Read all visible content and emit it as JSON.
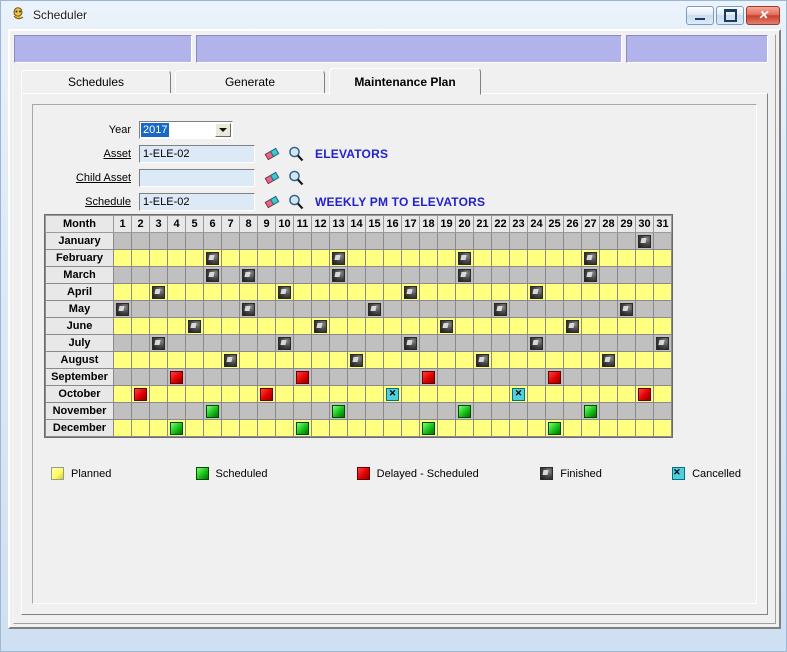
{
  "window": {
    "title": "Scheduler",
    "icon": "scheduler-app-icon",
    "buttons": {
      "minimize": "minimize-icon",
      "maximize": "maximize-icon",
      "close": "close-icon"
    }
  },
  "header_panels": [
    "",
    "",
    ""
  ],
  "tabs": [
    {
      "label": "Schedules",
      "active": false
    },
    {
      "label": "Generate",
      "active": false
    },
    {
      "label": "Maintenance Plan",
      "active": true
    }
  ],
  "form": {
    "year": {
      "label": "Year",
      "value": "2017",
      "selected": true
    },
    "asset": {
      "label": "Asset",
      "value": "1-ELE-02",
      "description": "ELEVATORS"
    },
    "child_asset": {
      "label": "Child Asset",
      "value": "",
      "description": ""
    },
    "schedule": {
      "label": "Schedule",
      "value": "1-ELE-02",
      "description": "WEEKLY PM TO ELEVATORS"
    },
    "icons": {
      "erase": "eraser-icon",
      "find": "magnifier-icon"
    }
  },
  "calendar": {
    "month_header": "Month",
    "days": [
      1,
      2,
      3,
      4,
      5,
      6,
      7,
      8,
      9,
      10,
      11,
      12,
      13,
      14,
      15,
      16,
      17,
      18,
      19,
      20,
      21,
      22,
      23,
      24,
      25,
      26,
      27,
      28,
      29,
      30,
      31
    ],
    "rows": [
      {
        "month": "January",
        "band": "gray",
        "marks": {
          "30": "finished"
        }
      },
      {
        "month": "February",
        "band": "yellow",
        "marks": {
          "6": "finished",
          "13": "finished",
          "20": "finished",
          "27": "finished"
        }
      },
      {
        "month": "March",
        "band": "gray",
        "marks": {
          "6": "finished",
          "8": "finished",
          "13": "finished",
          "20": "finished",
          "27": "finished"
        }
      },
      {
        "month": "April",
        "band": "yellow",
        "marks": {
          "3": "finished",
          "10": "finished",
          "17": "finished",
          "24": "finished"
        }
      },
      {
        "month": "May",
        "band": "gray",
        "marks": {
          "1": "finished",
          "8": "finished",
          "15": "finished",
          "22": "finished",
          "29": "finished"
        }
      },
      {
        "month": "June",
        "band": "yellow",
        "marks": {
          "5": "finished",
          "12": "finished",
          "19": "finished",
          "26": "finished"
        }
      },
      {
        "month": "July",
        "band": "gray",
        "marks": {
          "3": "finished",
          "10": "finished",
          "17": "finished",
          "24": "finished",
          "31": "finished"
        }
      },
      {
        "month": "August",
        "band": "yellow",
        "marks": {
          "7": "finished",
          "14": "finished",
          "21": "finished",
          "28": "finished"
        }
      },
      {
        "month": "September",
        "band": "gray",
        "marks": {
          "4": "delayed",
          "11": "delayed",
          "18": "delayed",
          "25": "delayed"
        }
      },
      {
        "month": "October",
        "band": "yellow",
        "marks": {
          "2": "delayed",
          "9": "delayed",
          "16": "cancelled",
          "23": "cancelled",
          "30": "delayed"
        }
      },
      {
        "month": "November",
        "band": "gray",
        "marks": {
          "6": "scheduled",
          "13": "scheduled",
          "20": "scheduled",
          "27": "scheduled"
        }
      },
      {
        "month": "December",
        "band": "yellow",
        "marks": {
          "4": "scheduled",
          "11": "scheduled",
          "18": "scheduled",
          "25": "scheduled"
        }
      }
    ]
  },
  "legend": [
    {
      "label": "Planned",
      "type": "planned",
      "color": "#ffff80"
    },
    {
      "label": "Scheduled",
      "type": "scheduled",
      "color": "#17c017"
    },
    {
      "label": "Delayed - Scheduled",
      "type": "delayed",
      "color": "#e00000"
    },
    {
      "label": "Finished",
      "type": "finished",
      "color": "#3a3a3a"
    },
    {
      "label": "Cancelled",
      "type": "cancelled",
      "color": "#4fd0e0"
    }
  ],
  "colors": {
    "planned_cell": "#ffff80",
    "alt_cell": "#c0c0c0",
    "panel": "#b3b3ec",
    "link_text": "#2222cc",
    "selection": "#1868c8"
  }
}
